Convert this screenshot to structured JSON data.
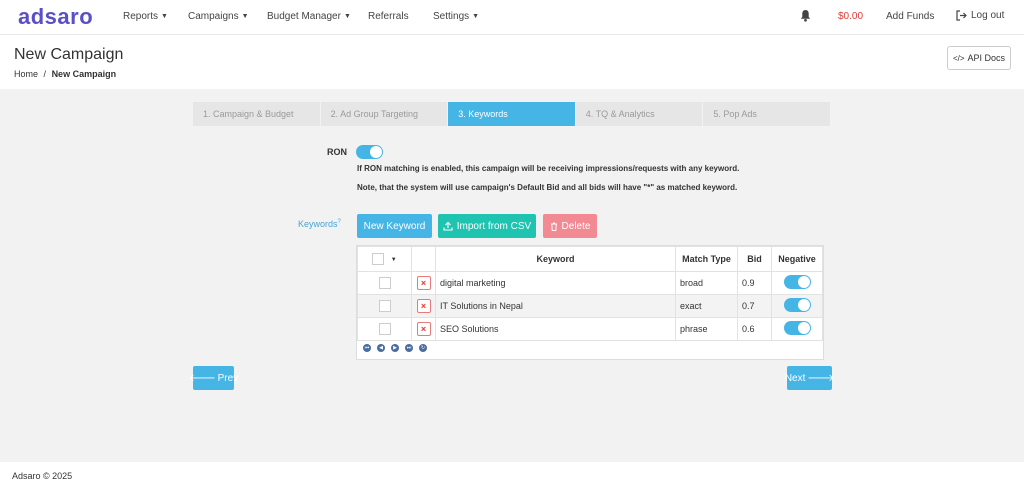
{
  "brand": {
    "logo": "adsaro",
    "logo_color": "#5a4fc7"
  },
  "topnav": {
    "items": [
      {
        "label": "Reports",
        "caret": true
      },
      {
        "label": "Campaigns",
        "caret": true
      },
      {
        "label": "Budget Manager",
        "caret": true
      },
      {
        "label": "Referrals",
        "caret": false
      },
      {
        "label": "Settings",
        "caret": true
      }
    ],
    "balance": "$0.00",
    "add_funds": "Add Funds",
    "logout": "Log out",
    "icons": [
      "bell-icon",
      "logout-icon"
    ]
  },
  "page": {
    "title": "New Campaign",
    "breadcrumb": {
      "home": "Home",
      "sep": "/",
      "current": "New Campaign"
    },
    "api_docs": "API Docs"
  },
  "steps": [
    {
      "label": "1. Campaign & Budget",
      "active": false
    },
    {
      "label": "2. Ad Group Targeting",
      "active": false
    },
    {
      "label": "3. Keywords",
      "active": true
    },
    {
      "label": "4. TQ & Analytics",
      "active": false
    },
    {
      "label": "5. Pop Ads",
      "active": false
    }
  ],
  "ron": {
    "label": "RON",
    "enabled": true,
    "note1": "If RON matching is enabled, this campaign will be receiving impressions/requests with any keyword.",
    "note2": "Note, that the system will use campaign's Default Bid and all bids will have \"*\" as matched keyword."
  },
  "keywords": {
    "label": "Keywords",
    "help": "?",
    "new_button": "New Keyword",
    "import_button": "Import from CSV",
    "delete_button": "Delete",
    "columns": {
      "keyword": "Keyword",
      "match_type": "Match Type",
      "bid": "Bid",
      "negative": "Negative"
    },
    "rows": [
      {
        "keyword": "digital marketing",
        "match_type": "broad",
        "bid": "0.9",
        "negative": true
      },
      {
        "keyword": "IT Solutions in Nepal",
        "match_type": "exact",
        "bid": "0.7",
        "negative": true
      },
      {
        "keyword": "SEO Solutions",
        "match_type": "phrase",
        "bid": "0.6",
        "negative": true
      }
    ]
  },
  "nav_buttons": {
    "prev": "Prev",
    "next": "Next"
  },
  "footer": {
    "text": "Adsaro © 2025"
  },
  "colors": {
    "accent": "#45b5e6",
    "teal": "#1fc4b0",
    "danger": "#f28a93",
    "balance": "#e53935"
  }
}
